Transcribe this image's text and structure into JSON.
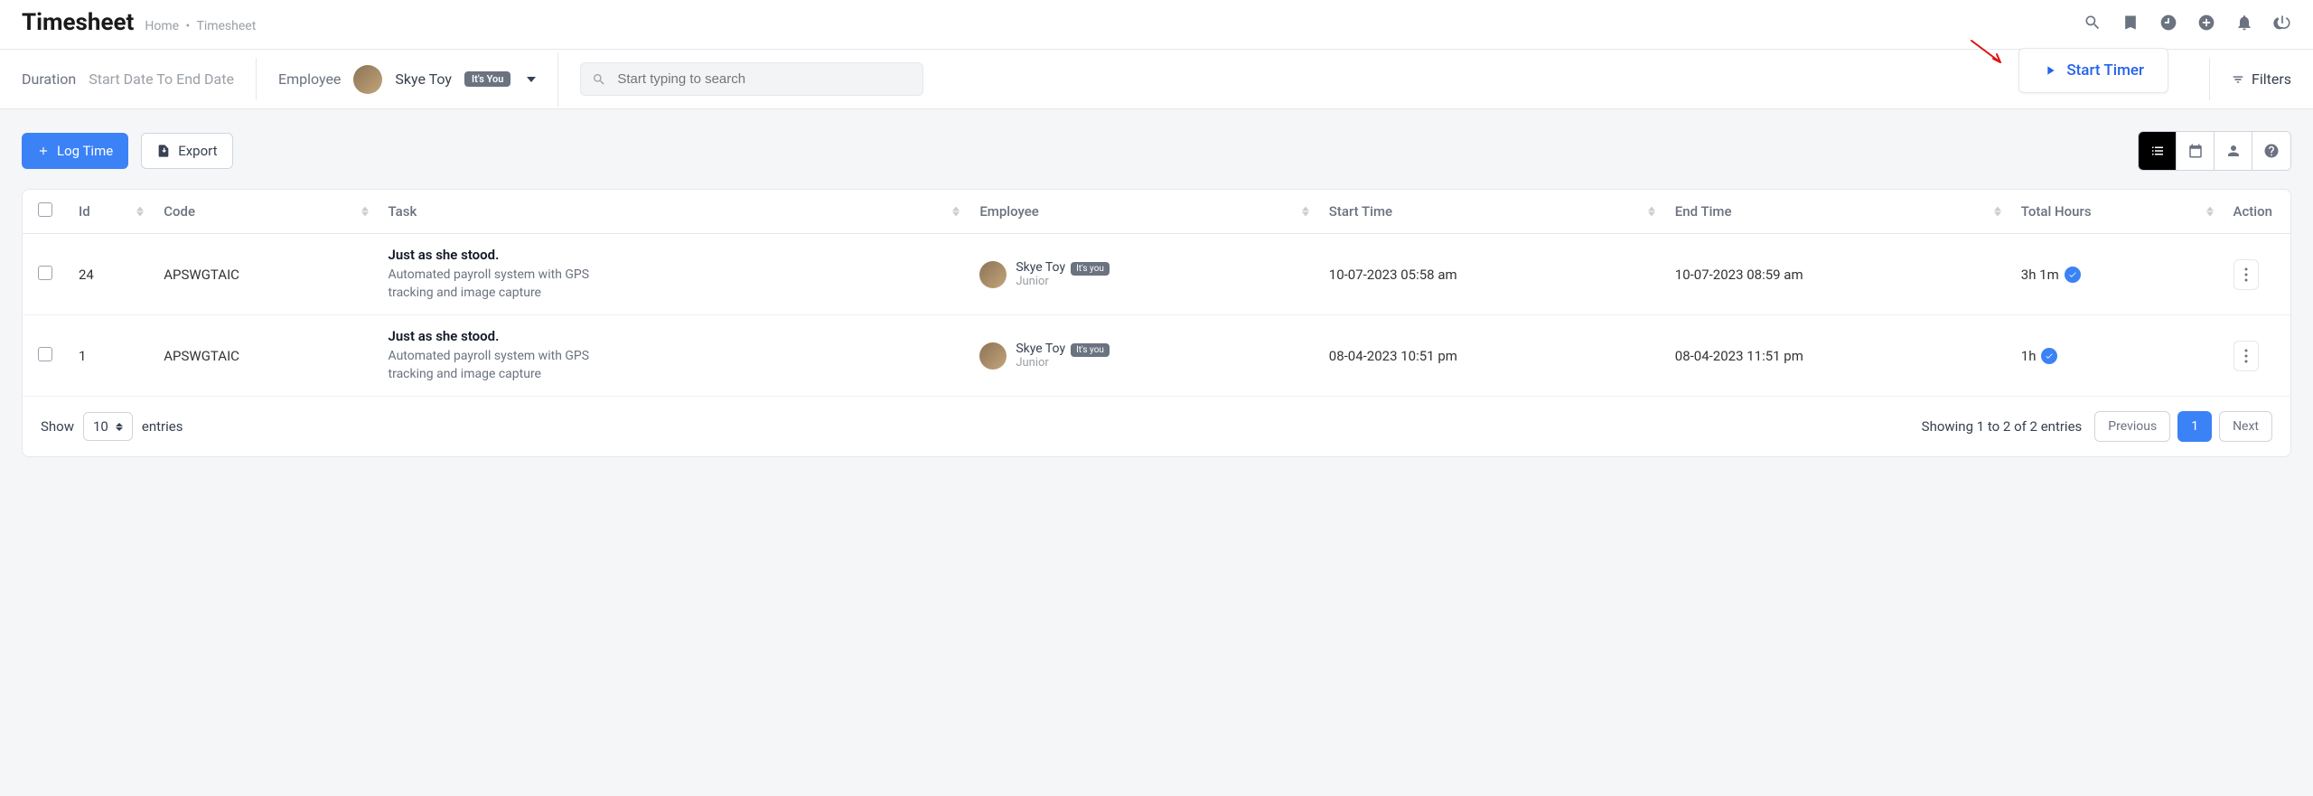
{
  "header": {
    "title": "Timesheet",
    "crumb_home": "Home",
    "crumb_current": "Timesheet"
  },
  "topbar": {
    "duration_label": "Duration",
    "duration_placeholder": "Start Date To End Date",
    "employee_label": "Employee",
    "employee_name": "Skye Toy",
    "employee_badge": "It's You",
    "search_placeholder": "Start typing to search",
    "start_timer_label": "Start Timer",
    "filters_label": "Filters"
  },
  "actions": {
    "log_time": "Log Time",
    "export": "Export"
  },
  "table": {
    "headers": {
      "id": "Id",
      "code": "Code",
      "task": "Task",
      "employee": "Employee",
      "start_time": "Start Time",
      "end_time": "End Time",
      "total_hours": "Total Hours",
      "action": "Action"
    },
    "rows": [
      {
        "id": "24",
        "code": "APSWGTAIC",
        "task_title": "Just as she stood.",
        "task_desc": "Automated payroll system with GPS tracking and image capture",
        "emp_name": "Skye Toy",
        "emp_badge": "It's you",
        "emp_role": "Junior",
        "start": "10-07-2023 05:58 am",
        "end": "10-07-2023 08:59 am",
        "hours": "3h 1m"
      },
      {
        "id": "1",
        "code": "APSWGTAIC",
        "task_title": "Just as she stood.",
        "task_desc": "Automated payroll system with GPS tracking and image capture",
        "emp_name": "Skye Toy",
        "emp_badge": "It's you",
        "emp_role": "Junior",
        "start": "08-04-2023 10:51 pm",
        "end": "08-04-2023 11:51 pm",
        "hours": "1h"
      }
    ]
  },
  "footer": {
    "show_label": "Show",
    "page_size": "10",
    "entries_label": "entries",
    "info": "Showing 1 to 2 of 2 entries",
    "prev": "Previous",
    "page": "1",
    "next": "Next"
  }
}
